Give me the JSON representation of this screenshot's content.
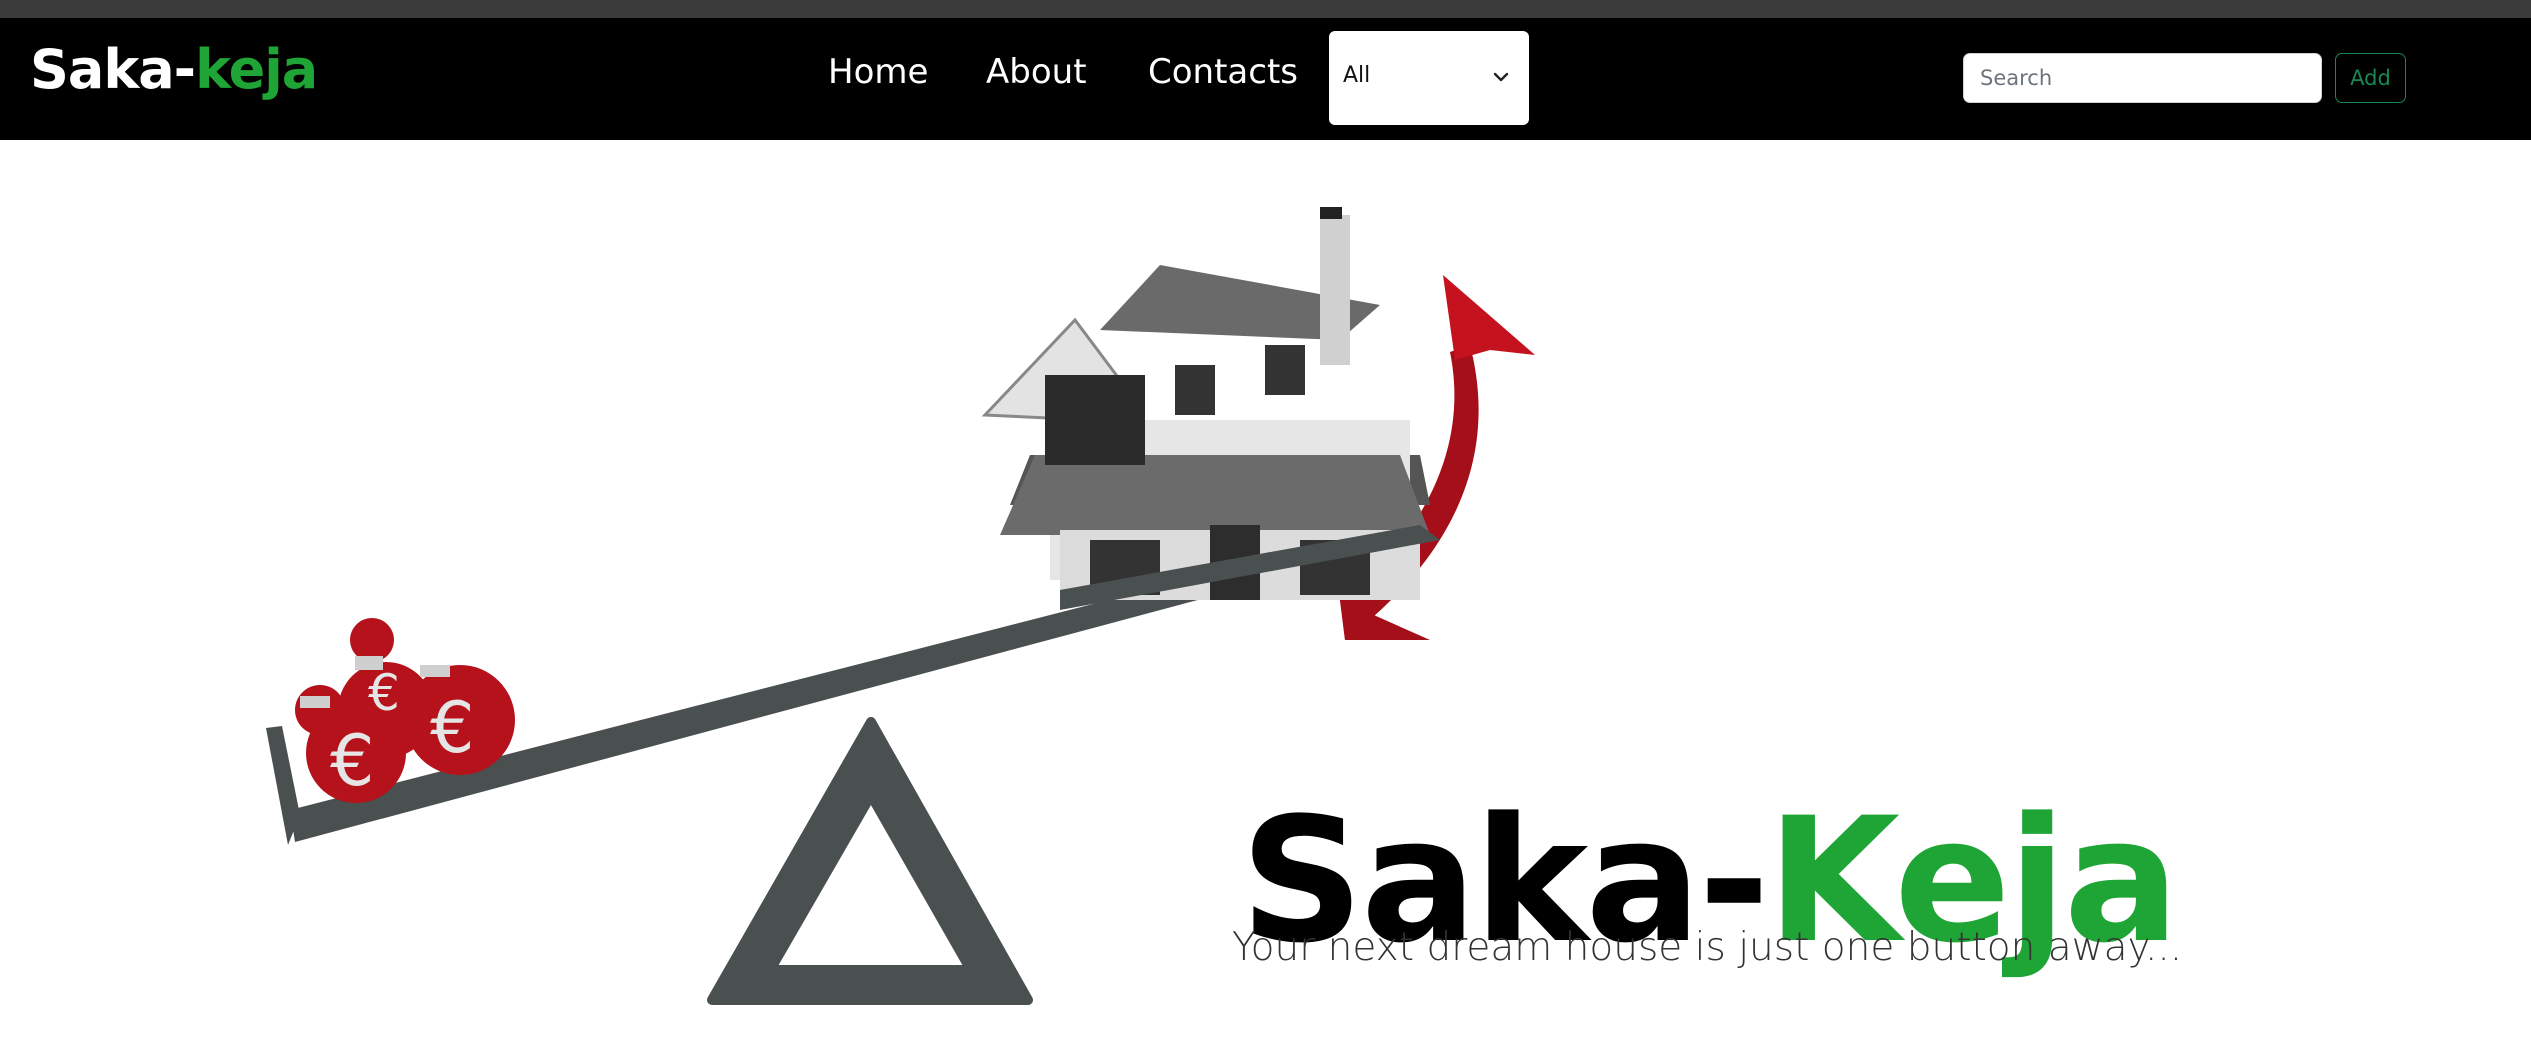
{
  "brand": {
    "prefix": "Saka-",
    "accent": "keja"
  },
  "nav": {
    "home": "Home",
    "about": "About",
    "contacts": "Contacts"
  },
  "filter": {
    "selected": "All"
  },
  "search": {
    "placeholder": "Search"
  },
  "add_button": {
    "label": "Add"
  },
  "hero": {
    "title_prefix": "Saka-",
    "title_accent": "Keja",
    "tagline": "Your next dream house is just one button away..."
  },
  "colors": {
    "accent_green": "#1fa535",
    "navbar": "#000000",
    "seesaw": "#4a4f4f",
    "money_bag": "#b5121b"
  }
}
